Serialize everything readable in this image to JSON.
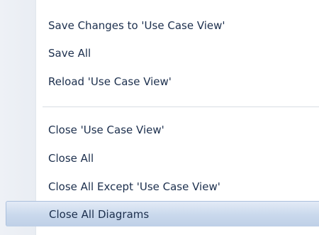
{
  "menu": {
    "items": [
      {
        "label": "Save Changes to 'Use Case View'"
      },
      {
        "label": "Save All"
      },
      {
        "label": "Reload 'Use Case View'"
      },
      {
        "label": "Close 'Use Case View'"
      },
      {
        "label": "Close All"
      },
      {
        "label": "Close All Except 'Use Case View'"
      },
      {
        "label": "Close All Diagrams"
      }
    ],
    "highlighted_item": "Close All Diagrams"
  },
  "colors": {
    "text": "#1c2f4d",
    "highlight": "#c9d8ec",
    "gutter": "#eef1f6",
    "separator": "#d8dde4"
  }
}
